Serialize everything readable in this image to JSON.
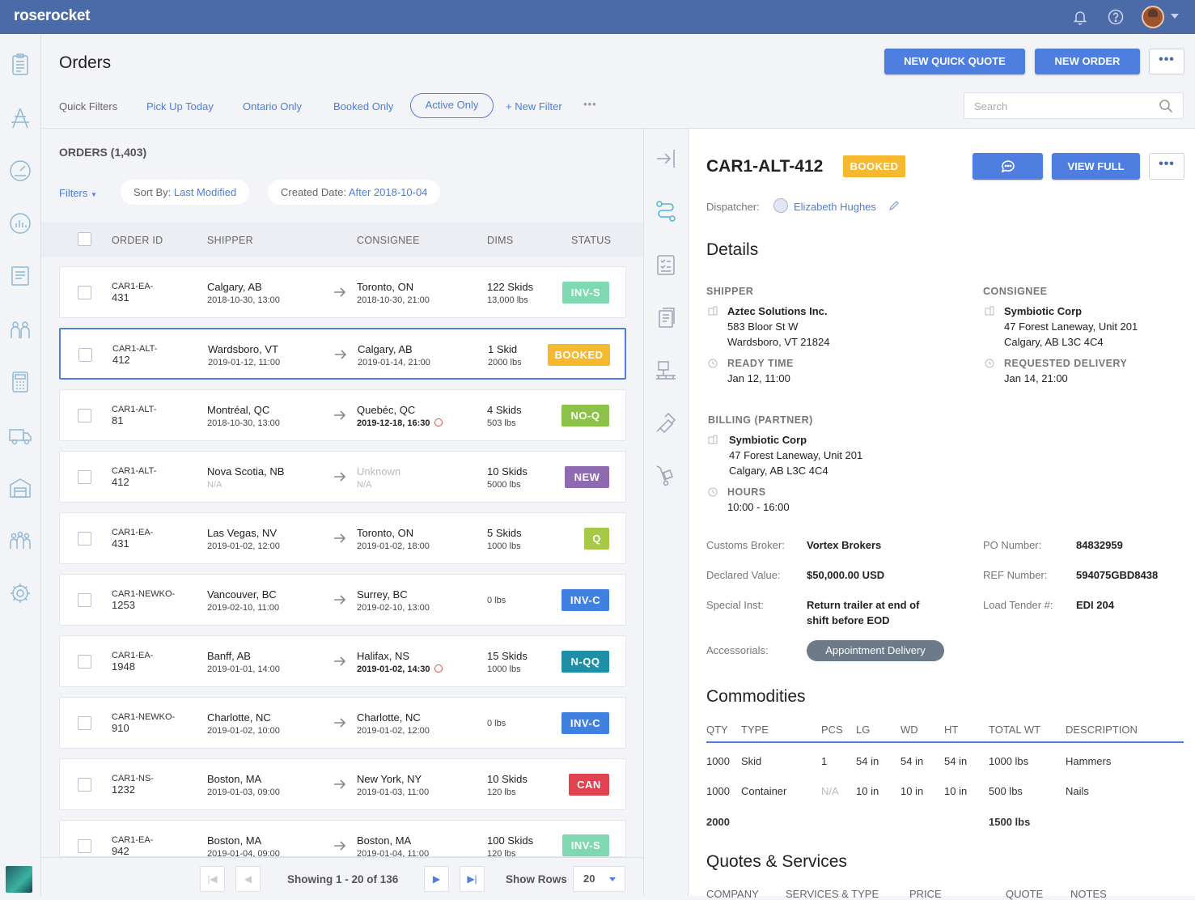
{
  "app": {
    "logo": "roserocket"
  },
  "header": {
    "title": "Orders",
    "new_quick_quote": "NEW QUICK QUOTE",
    "new_order": "NEW ORDER",
    "more": "•••"
  },
  "quick_filters": {
    "label": "Quick Filters",
    "items": [
      "Pick Up Today",
      "Ontario Only",
      "Booked Only",
      "Active Only"
    ],
    "active": "Active Only",
    "new_filter": "+ New Filter",
    "more": "•••"
  },
  "search": {
    "placeholder": "Search"
  },
  "orders": {
    "count_label": "ORDERS (1,403)",
    "filters_label": "Filters",
    "sort_by_label": "Sort By:",
    "sort_by_value": "Last Modified",
    "created_label": "Created Date:",
    "created_value": "After 2018-10-04",
    "columns": [
      "ORDER ID",
      "SHIPPER",
      "CONSIGNEE",
      "DIMS",
      "STATUS"
    ],
    "rows": [
      {
        "id1": "CAR1-EA-",
        "id2": "431",
        "shipper": "Calgary, AB",
        "ship_date": "2018-10-30, 13:00",
        "consignee": "Toronto, ON",
        "cons_date": "2018-10-30, 21:00",
        "dims1": "122 Skids",
        "dims2": "13,000 lbs",
        "status": "INV-S",
        "color": "#7ed9b0"
      },
      {
        "id1": "CAR1-ALT-",
        "id2": "412",
        "shipper": "Wardsboro, VT",
        "ship_date": "2019-01-12, 11:00",
        "consignee": "Calgary, AB",
        "cons_date": "2019-01-14, 21:00",
        "dims1": "1 Skid",
        "dims2": "2000 lbs",
        "status": "BOOKED",
        "color": "#f5b82e"
      },
      {
        "id1": "CAR1-ALT-",
        "id2": "81",
        "shipper": "Montréal, QC",
        "ship_date": "2018-10-30, 13:00",
        "consignee": "Quebéc, QC",
        "cons_date": "2019-12-18, 16:30",
        "dims1": "4 Skids",
        "dims2": "503 lbs",
        "status": "NO-Q",
        "color": "#8dc24a"
      },
      {
        "id1": "CAR1-ALT-",
        "id2": "412",
        "shipper": "Nova Scotia, NB",
        "ship_date": "N/A",
        "consignee": "Unknown",
        "cons_date": "N/A",
        "dims1": "10 Skids",
        "dims2": "5000 lbs",
        "status": "NEW",
        "color": "#8e6bb0"
      },
      {
        "id1": "CAR1-EA-",
        "id2": "431",
        "shipper": "Las Vegas, NV",
        "ship_date": "2019-01-02, 12:00",
        "consignee": "Toronto, ON",
        "cons_date": "2019-01-02, 18:00",
        "dims1": "5 Skids",
        "dims2": "1000 lbs",
        "status": "Q",
        "color": "#a8c848"
      },
      {
        "id1": "CAR1-NEWKO-",
        "id2": "1253",
        "shipper": "Vancouver, BC",
        "ship_date": "2019-02-10, 11:00",
        "consignee": "Surrey, BC",
        "cons_date": "2019-02-10, 13:00",
        "dims1": "",
        "dims2": "0 lbs",
        "status": "INV-C",
        "color": "#3f80e0"
      },
      {
        "id1": "CAR1-EA-",
        "id2": "1948",
        "shipper": "Banff, AB",
        "ship_date": "2019-01-01, 14:00",
        "consignee": "Halifax, NS",
        "cons_date": "2019-01-02, 14:30",
        "dims1": "15 Skids",
        "dims2": "1000 lbs",
        "status": "N-QQ",
        "color": "#1f8fa8"
      },
      {
        "id1": "CAR1-NEWKO-",
        "id2": "910",
        "shipper": "Charlotte, NC",
        "ship_date": "2019-01-02, 10:00",
        "consignee": "Charlotte, NC",
        "cons_date": "2019-01-02, 12:00",
        "dims1": "",
        "dims2": "0 lbs",
        "status": "INV-C",
        "color": "#3f80e0"
      },
      {
        "id1": "CAR1-NS-",
        "id2": "1232",
        "shipper": "Boston, MA",
        "ship_date": "2019-01-03, 09:00",
        "consignee": "New York, NY",
        "cons_date": "2019-01-03, 11:00",
        "dims1": "10 Skids",
        "dims2": "120 lbs",
        "status": "CAN",
        "color": "#e0434f"
      },
      {
        "id1": "CAR1-EA-",
        "id2": "942",
        "shipper": "Boston, MA",
        "ship_date": "2019-01-04, 09:00",
        "consignee": "Boston, MA",
        "cons_date": "2019-01-04, 11:00",
        "dims1": "100 Skids",
        "dims2": "120 lbs",
        "status": "INV-S",
        "color": "#7ed9b0"
      }
    ]
  },
  "pager": {
    "first": "|◀",
    "prev": "◀",
    "showing": "Showing 1 - 20 of 136",
    "next": "▶",
    "last": "▶|",
    "show_rows_label": "Show Rows",
    "rows_value": "20"
  },
  "detail": {
    "order_id": "CAR1-ALT-412",
    "status": "BOOKED",
    "view_full": "VIEW FULL",
    "more": "•••",
    "dispatcher_label": "Dispatcher:",
    "dispatcher_name": "Elizabeth Hughes",
    "details_heading": "Details",
    "shipper": {
      "heading": "SHIPPER",
      "name": "Aztec Solutions Inc.",
      "addr1": "583 Bloor St W",
      "addr2": "Wardsboro, VT 21824",
      "time_label": "READY TIME",
      "time": "Jan 12, 11:00"
    },
    "consignee": {
      "heading": "CONSIGNEE",
      "name": "Symbiotic Corp",
      "addr1": "47 Forest Laneway, Unit 201",
      "addr2": "Calgary, AB L3C 4C4",
      "time_label": "REQUESTED DELIVERY",
      "time": "Jan 14, 21:00"
    },
    "billing": {
      "heading": "BILLING (PARTNER)",
      "name": "Symbiotic Corp",
      "addr1": "47 Forest Laneway, Unit 201",
      "addr2": "Calgary, AB L3C 4C4",
      "hours_label": "HOURS",
      "hours": "10:00 - 16:00"
    },
    "fields": {
      "customs_broker_label": "Customs Broker:",
      "customs_broker": "Vortex Brokers",
      "po_label": "PO Number:",
      "po": "84832959",
      "declared_label": "Declared Value:",
      "declared": "$50,000.00 USD",
      "ref_label": "REF Number:",
      "ref": "594075GBD8438",
      "special_label": "Special Inst:",
      "special1": "Return trailer at end of",
      "special2": "shift before EOD",
      "load_label": "Load Tender #:",
      "load": "EDI 204",
      "accessorials_label": "Accessorials:",
      "accessorial": "Appointment Delivery"
    },
    "commodities": {
      "heading": "Commodities",
      "columns": [
        "QTY",
        "TYPE",
        "PCS",
        "LG",
        "WD",
        "HT",
        "TOTAL WT",
        "DESCRIPTION"
      ],
      "rows": [
        {
          "qty": "1000",
          "type": "Skid",
          "pcs": "1",
          "lg": "54 in",
          "wd": "54 in",
          "ht": "54 in",
          "wt": "1000 lbs",
          "desc": "Hammers"
        },
        {
          "qty": "1000",
          "type": "Container",
          "pcs": "N/A",
          "lg": "10 in",
          "wd": "10 in",
          "ht": "10 in",
          "wt": "500 lbs",
          "desc": "Nails"
        }
      ],
      "total_qty": "2000",
      "total_wt": "1500 lbs"
    },
    "quotes": {
      "heading": "Quotes & Services",
      "columns": [
        "COMPANY",
        "SERVICES & TYPE",
        "PRICE",
        "QUOTE",
        "NOTES"
      ]
    }
  }
}
